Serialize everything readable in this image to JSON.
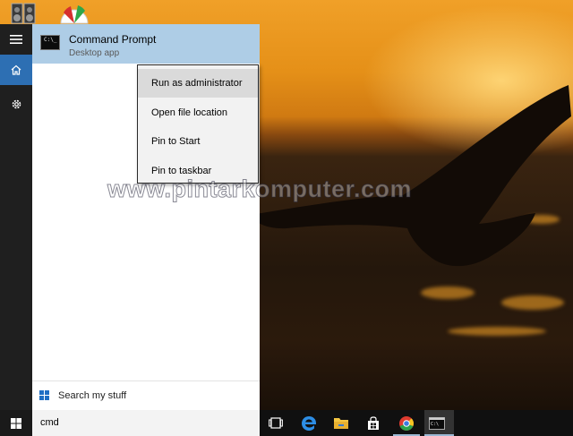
{
  "start_menu": {
    "result": {
      "title": "Command Prompt",
      "subtitle": "Desktop app",
      "icon": "cmd-icon"
    },
    "search_my_stuff": "Search my stuff"
  },
  "context_menu": {
    "items": [
      {
        "label": "Run as administrator",
        "highlighted": true
      },
      {
        "label": "Open file location"
      },
      {
        "label": "Pin to Start"
      },
      {
        "label": "Pin to taskbar"
      }
    ]
  },
  "taskbar": {
    "search_text": "cmd",
    "icons": [
      "task-view-icon",
      "edge-icon",
      "file-explorer-icon",
      "store-icon",
      "chrome-icon",
      "cmd-icon"
    ]
  },
  "watermark": "www.pintarkomputer.com",
  "colors": {
    "selection": "#aecde6",
    "rail": "#1f1f1f",
    "accent": "#2d6fb3",
    "taskbar": "#101010"
  }
}
